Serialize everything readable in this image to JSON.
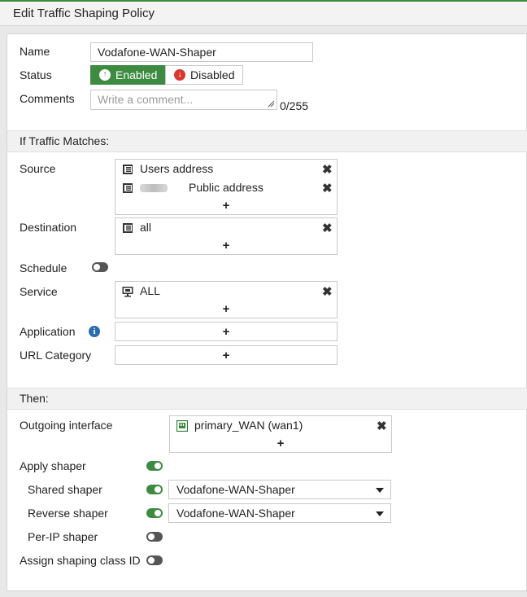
{
  "window": {
    "title": "Edit Traffic Shaping Policy"
  },
  "form": {
    "name_label": "Name",
    "name_value": "Vodafone-WAN-Shaper",
    "status_label": "Status",
    "status_enabled": "Enabled",
    "status_disabled": "Disabled",
    "comments_label": "Comments",
    "comments_placeholder": "Write a comment...",
    "comments_counter": "0/255"
  },
  "match": {
    "header": "If Traffic Matches:",
    "source_label": "Source",
    "source_items": [
      "Users address",
      "Public address"
    ],
    "destination_label": "Destination",
    "destination_items": [
      "all"
    ],
    "schedule_label": "Schedule",
    "service_label": "Service",
    "service_items": [
      "ALL"
    ],
    "application_label": "Application",
    "url_category_label": "URL Category",
    "add_symbol": "+",
    "remove_symbol": "✖"
  },
  "then": {
    "header": "Then:",
    "outgoing_label": "Outgoing interface",
    "outgoing_items": [
      "primary_WAN (wan1)"
    ],
    "apply_shaper_label": "Apply shaper",
    "shared_shaper_label": "Shared shaper",
    "shared_shaper_value": "Vodafone-WAN-Shaper",
    "reverse_shaper_label": "Reverse shaper",
    "reverse_shaper_value": "Vodafone-WAN-Shaper",
    "per_ip_label": "Per-IP shaper",
    "class_id_label": "Assign shaping class ID"
  },
  "toggles": {
    "schedule": false,
    "apply_shaper": true,
    "shared_shaper": true,
    "reverse_shaper": true,
    "per_ip_shaper": false,
    "assign_class_id": false
  },
  "icons": {
    "enabled": "arrow-up-circle-icon",
    "disabled": "arrow-down-circle-icon",
    "address": "address-book-icon",
    "service": "service-monitor-icon",
    "interface": "network-port-icon",
    "info": "info-icon"
  },
  "colors": {
    "accent": "#3d8b40",
    "danger": "#d9382f",
    "info": "#2b6cb0"
  }
}
